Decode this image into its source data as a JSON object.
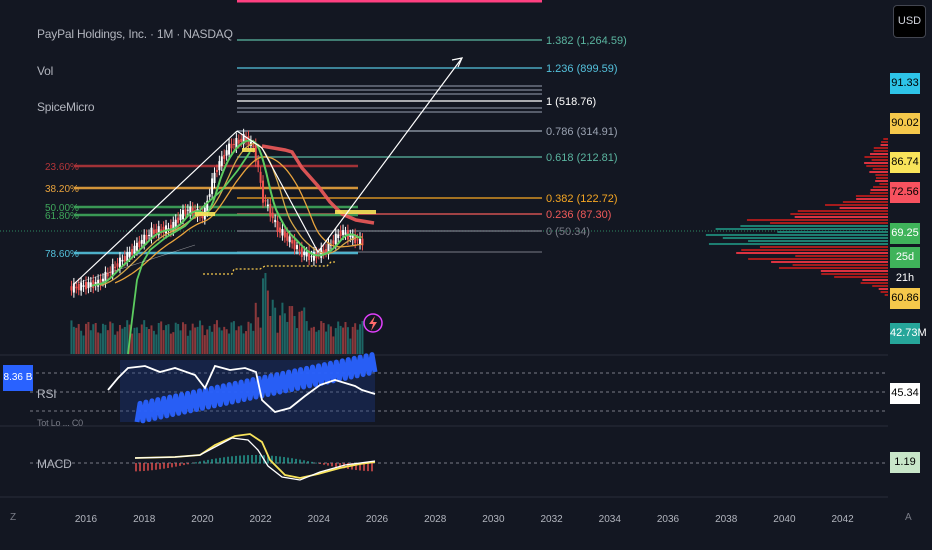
{
  "header": {
    "symbol_line": "PayPal Holdings, Inc. · 1M · NASDAQ",
    "indicator_vol": "Vol",
    "indicator_spice": "SpiceMicro",
    "currency_button": "USD"
  },
  "panes": {
    "rsi_label": "RSI",
    "rsi_value": "45.34",
    "macd_label": "MACD",
    "macd_value": "1.19",
    "volume_badge": "8.36 B",
    "partial_label": "Tot Lo ... C0",
    "corner_left": "Z",
    "corner_right": "A"
  },
  "price_tags": [
    {
      "label": "91.33",
      "bg": "#2ec4e8",
      "fg": "#000000"
    },
    {
      "label": "90.02",
      "bg": "#f5c84b",
      "fg": "#000000"
    },
    {
      "label": "86.74",
      "bg": "#f9e45a",
      "fg": "#000000"
    },
    {
      "label": "72.56",
      "bg": "#f7525f",
      "fg": "#000000"
    },
    {
      "label": "69.25",
      "bg": "#3fb35a",
      "fg": "#ffffff"
    },
    {
      "label": "25d 21h",
      "bg": "#3fb35a",
      "fg": "#ffffff"
    },
    {
      "label": "60.86",
      "bg": "#f5c84b",
      "fg": "#000000"
    },
    {
      "label": "42.73M",
      "bg": "#26a69a",
      "fg": "#ffffff"
    }
  ],
  "colors": {
    "background": "#131722",
    "candle_up": "#ffffff",
    "candle_down": "#ef5350",
    "ma_green": "#5ccb5f",
    "ma_red": "#f05a5a",
    "ma_orange": "#e8a33d",
    "rsi_band": "#2962ff",
    "fib_teal": "#5bb5a0",
    "fib_cyan": "#54c1dc",
    "fib_orange": "#f5a623",
    "fib_red": "#ef5350",
    "fib_pink": "#ff4081"
  },
  "chart_data": {
    "type": "candlestick",
    "title": "PayPal Holdings, Inc. · 1M · NASDAQ",
    "x_ticks": [
      "2016",
      "2018",
      "2020",
      "2022",
      "2024",
      "2026",
      "2028",
      "2030",
      "2032",
      "2034",
      "2036",
      "2038",
      "2040",
      "2042"
    ],
    "x_range": [
      2015.6,
      2043.5
    ],
    "price_anchors": [
      {
        "t": 2015.5,
        "v": 36
      },
      {
        "t": 2016.5,
        "v": 39
      },
      {
        "t": 2017.5,
        "v": 58
      },
      {
        "t": 2018.3,
        "v": 80
      },
      {
        "t": 2018.95,
        "v": 84
      },
      {
        "t": 2019.5,
        "v": 110
      },
      {
        "t": 2020.1,
        "v": 100
      },
      {
        "t": 2020.5,
        "v": 190
      },
      {
        "t": 2021.0,
        "v": 270
      },
      {
        "t": 2021.5,
        "v": 300
      },
      {
        "t": 2021.8,
        "v": 260
      },
      {
        "t": 2022.1,
        "v": 130
      },
      {
        "t": 2022.6,
        "v": 84
      },
      {
        "t": 2022.9,
        "v": 75
      },
      {
        "t": 2023.4,
        "v": 60
      },
      {
        "t": 2023.8,
        "v": 56
      },
      {
        "t": 2024.3,
        "v": 62
      },
      {
        "t": 2024.8,
        "v": 80
      },
      {
        "t": 2025.1,
        "v": 75
      },
      {
        "t": 2025.5,
        "v": 69
      }
    ],
    "fib_extension": [
      {
        "ratio": "0 (50.34)",
        "color": "#787b86"
      },
      {
        "ratio": "0.236 (87.30)",
        "color": "#f05a5a"
      },
      {
        "ratio": "0.382 (122.72)",
        "color": "#f5a623"
      },
      {
        "ratio": "0.618 (212.81)",
        "color": "#5bb5a0"
      },
      {
        "ratio": "0.786 (314.91)",
        "color": "#9aa2b1"
      },
      {
        "ratio": "1 (518.76)",
        "color": "#ffffff"
      },
      {
        "ratio": "1.236 (899.59)",
        "color": "#54c1dc"
      },
      {
        "ratio": "1.382 (1,264.59)",
        "color": "#5bb5a0"
      }
    ],
    "fib_retracement": [
      {
        "label": "23.60%",
        "color": "#b2353a"
      },
      {
        "label": "38.20%",
        "color": "#e8a33d"
      },
      {
        "label": "50.00%",
        "color": "#3fa75b"
      },
      {
        "label": "61.80%",
        "color": "#3fa75b"
      },
      {
        "label": "78.60%",
        "color": "#54c1dc"
      }
    ],
    "rsi": {
      "current": 45.34
    },
    "macd": {
      "current": 1.19
    }
  }
}
